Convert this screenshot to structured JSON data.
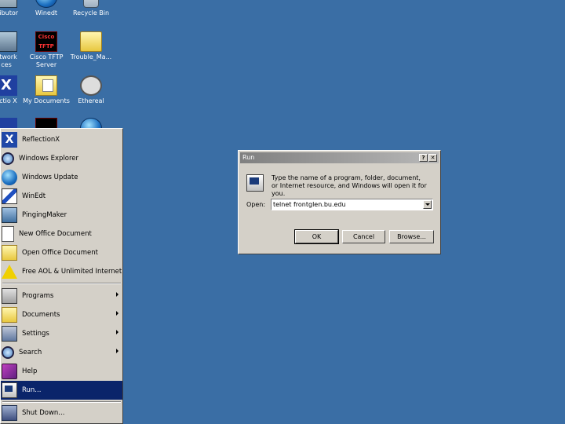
{
  "desktop": {
    "icons": [
      {
        "label": "tributor",
        "icon": "computer-icon"
      },
      {
        "label": "Winedt",
        "icon": "globe-icon"
      },
      {
        "label": "Recycle Bin",
        "icon": "recycle-bin-icon"
      },
      {
        "label": "etwork\nces",
        "icon": "network-icon"
      },
      {
        "label": "Cisco TFTP\nServer",
        "icon": "cisco-tftp-icon"
      },
      {
        "label": "Trouble_Ma...",
        "icon": "folder-icon"
      },
      {
        "label": "ectio X",
        "icon": "reflection-x-icon"
      },
      {
        "label": "My Documents",
        "icon": "my-documents-icon"
      },
      {
        "label": "Ethereal",
        "icon": "ethereal-icon"
      }
    ],
    "cisco_icon_text": "Cisco\nTFTP"
  },
  "start_menu": {
    "items": [
      {
        "label": "ReflectionX",
        "icon": "reflection-x-icon"
      },
      {
        "label": "Windows Explorer",
        "icon": "magnifier-icon"
      },
      {
        "label": "Windows Update",
        "icon": "globe-icon"
      },
      {
        "label": "WinEdt",
        "icon": "pen-icon"
      },
      {
        "label": "PingingMaker",
        "icon": "network-icon"
      },
      {
        "label": "New Office Document",
        "icon": "document-icon"
      },
      {
        "label": "Open Office Document",
        "icon": "open-folder-icon"
      },
      {
        "label": "Free AOL & Unlimited Internet",
        "icon": "aol-icon"
      },
      {
        "label": "Programs",
        "icon": "programs-icon",
        "submenu": true
      },
      {
        "label": "Documents",
        "icon": "folder-icon",
        "submenu": true
      },
      {
        "label": "Settings",
        "icon": "settings-icon",
        "submenu": true
      },
      {
        "label": "Search",
        "icon": "search-icon",
        "submenu": true
      },
      {
        "label": "Help",
        "icon": "help-icon"
      },
      {
        "label": "Run...",
        "icon": "run-icon",
        "selected": true
      },
      {
        "label": "Shut Down...",
        "icon": "shutdown-icon"
      }
    ]
  },
  "run_dialog": {
    "title": "Run",
    "help_button": "?",
    "close_button": "✕",
    "description": "Type the name of a program, folder, document, or Internet resource, and Windows will open it for you.",
    "open_label": "Open:",
    "open_value": "telnet frontglen.bu.edu",
    "ok_label": "OK",
    "cancel_label": "Cancel",
    "browse_label": "Browse..."
  },
  "colors": {
    "desktop": "#3a6ea5",
    "selected": "#0a246a",
    "face": "#d4d0c8"
  }
}
